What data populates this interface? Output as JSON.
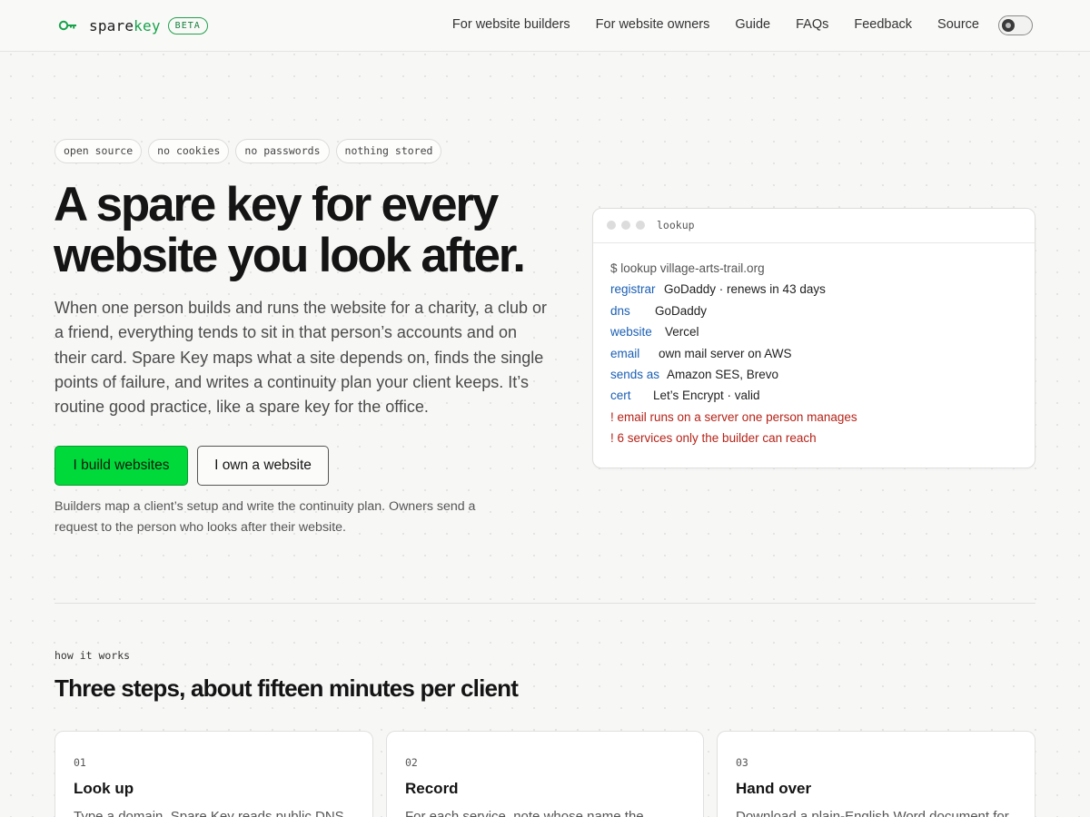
{
  "brand": {
    "name_prefix": "spare",
    "name_highlight": "key",
    "badge": "BETA"
  },
  "nav": [
    {
      "label": "For website builders"
    },
    {
      "label": "For website owners"
    },
    {
      "label": "Guide"
    },
    {
      "label": "FAQs"
    },
    {
      "label": "Feedback"
    },
    {
      "label": "Source"
    }
  ],
  "tags": [
    "open source",
    "no cookies",
    "no passwords",
    "nothing stored"
  ],
  "hero": {
    "title_line1": "A spare key for every",
    "title_line2": "website you look after.",
    "description": "When one person builds and runs the website for a charity, a club or a friend, everything tends to sit in that person’s accounts and on their card. Spare Key maps what a site depends on, finds the single points of failure, and writes a continuity plan your client keeps. It’s routine good practice, like a spare key for the office.",
    "primary_button": "I build websites",
    "secondary_button": "I own a website",
    "note": "Builders map a client’s setup and write the continuity plan. Owners send a request to the person who looks after their website."
  },
  "terminal": {
    "title": "lookup",
    "command": "$ lookup village-arts-trail.org",
    "rows": [
      {
        "key": "registrar",
        "value": "GoDaddy · renews in 43 days"
      },
      {
        "key": "dns",
        "value": "GoDaddy"
      },
      {
        "key": "website",
        "value": "Vercel"
      },
      {
        "key": "email",
        "value": "own mail server on AWS"
      },
      {
        "key": "sends as",
        "value": "Amazon SES, Brevo"
      },
      {
        "key": "cert",
        "value": "Let’s Encrypt · valid"
      }
    ],
    "warnings": [
      "! email runs on a server one person manages",
      "! 6 services only the builder can reach"
    ]
  },
  "how_it_works": {
    "kicker": "how it works",
    "title": "Three steps, about fifteen minutes per client",
    "steps": [
      {
        "num": "01",
        "title": "Look up",
        "text": "Type a domain. Spare Key reads public DNS"
      },
      {
        "num": "02",
        "title": "Record",
        "text": "For each service, note whose name the"
      },
      {
        "num": "03",
        "title": "Hand over",
        "text": "Download a plain-English Word document for"
      }
    ]
  },
  "colors": {
    "accent_green": "#00d93a",
    "brand_green": "#17a34a",
    "key_blue": "#1a5fb4",
    "warning_red": "#b42318"
  },
  "icons": {
    "logo": "key-icon",
    "theme_toggle": "sun-icon"
  }
}
